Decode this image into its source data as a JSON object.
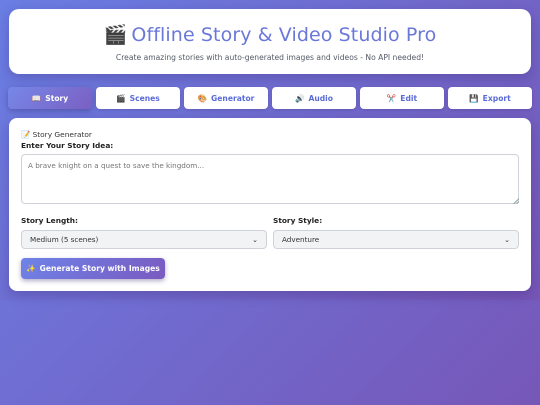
{
  "header": {
    "icon": "clapperboard-icon",
    "icon_glyph": "🎬",
    "title": "Offline Story & Video Studio Pro",
    "subtitle": "Create amazing stories with auto-generated images and videos - No API needed!"
  },
  "tabs": [
    {
      "icon": "book-icon",
      "glyph": "📖",
      "label": "Story",
      "active": true
    },
    {
      "icon": "clapperboard-icon",
      "glyph": "🎬",
      "label": "Scenes",
      "active": false
    },
    {
      "icon": "palette-icon",
      "glyph": "🎨",
      "label": "Generator",
      "active": false
    },
    {
      "icon": "speaker-icon",
      "glyph": "🔊",
      "label": "Audio",
      "active": false
    },
    {
      "icon": "scissors-icon",
      "glyph": "✂️",
      "label": "Edit",
      "active": false
    },
    {
      "icon": "floppy-disk-icon",
      "glyph": "💾",
      "label": "Export",
      "active": false
    }
  ],
  "panel": {
    "heading_glyph": "📝",
    "heading": "Story Generator",
    "idea_label": "Enter Your Story Idea:",
    "idea_placeholder": "A brave knight on a quest to save the kingdom...",
    "idea_value": "",
    "length_label": "Story Length:",
    "length_selected": "Medium (5 scenes)",
    "style_label": "Story Style:",
    "style_selected": "Adventure",
    "generate_glyph": "✨",
    "generate_label": "Generate Story with Images"
  },
  "colors": {
    "accent": "#6a78d8",
    "gradient_start": "#6b7fe6",
    "gradient_end": "#7657b8"
  }
}
